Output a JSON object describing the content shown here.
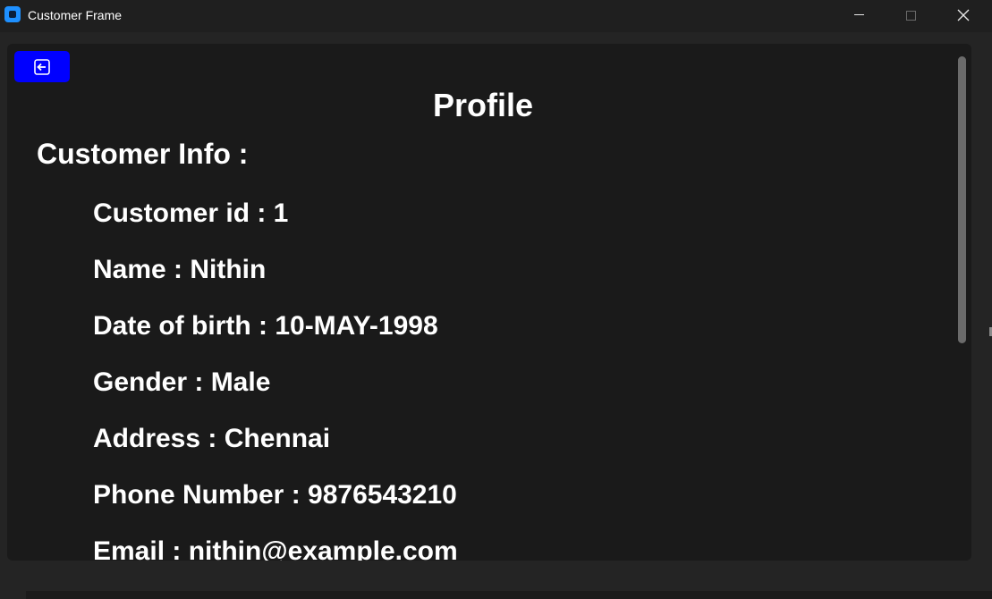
{
  "window": {
    "title": "Customer Frame",
    "accent_color": "#1e90ff"
  },
  "toolbar": {
    "back_icon": "back-arrow-icon",
    "back_color": "#0000ff"
  },
  "main": {
    "title": "Profile",
    "section_title": "Customer Info :",
    "rows": [
      {
        "text": "Customer id : 1"
      },
      {
        "text": "Name : Nithin"
      },
      {
        "text": "Date of birth : 10-MAY-1998"
      },
      {
        "text": "Gender : Male"
      },
      {
        "text": "Address : Chennai"
      },
      {
        "text": "Phone Number : 9876543210"
      },
      {
        "text": "Email : nithin@example.com"
      }
    ]
  }
}
